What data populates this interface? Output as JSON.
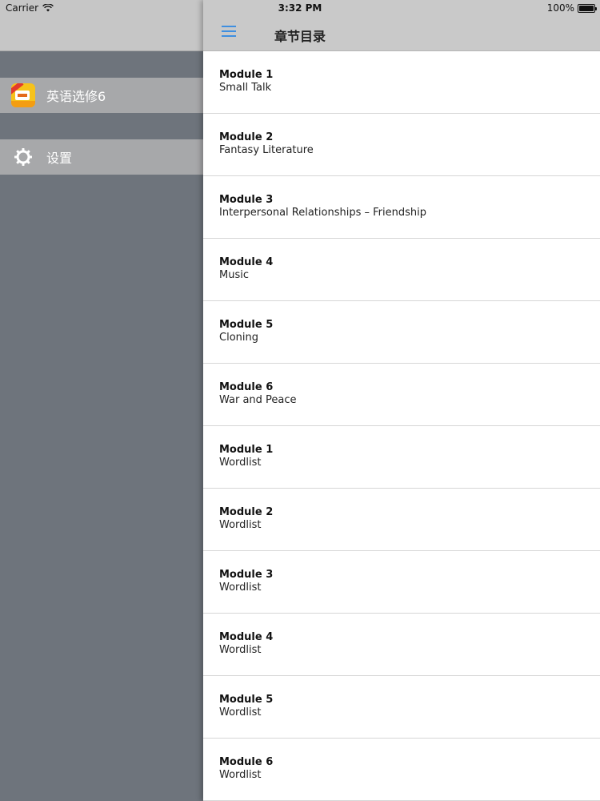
{
  "status_bar": {
    "carrier": "Carrier",
    "time": "3:32 PM",
    "battery": "100%"
  },
  "sidebar": {
    "items": [
      {
        "label": "英语选修6",
        "icon": "book-app-icon"
      },
      {
        "label": "设置",
        "icon": "gear-icon"
      }
    ]
  },
  "navbar": {
    "title": "章节目录",
    "menu_icon": "hamburger-menu-icon",
    "accent": "#3f8fe0"
  },
  "chapters": [
    {
      "title": "Module 1",
      "subtitle": "Small Talk"
    },
    {
      "title": "Module 2",
      "subtitle": "Fantasy Literature"
    },
    {
      "title": "Module 3",
      "subtitle": "Interpersonal Relationships – Friendship"
    },
    {
      "title": "Module 4",
      "subtitle": "Music"
    },
    {
      "title": "Module 5",
      "subtitle": "Cloning"
    },
    {
      "title": "Module 6",
      "subtitle": "War and Peace"
    },
    {
      "title": "Module 1",
      "subtitle": "Wordlist"
    },
    {
      "title": "Module 2",
      "subtitle": "Wordlist"
    },
    {
      "title": "Module 3",
      "subtitle": "Wordlist"
    },
    {
      "title": "Module 4",
      "subtitle": "Wordlist"
    },
    {
      "title": "Module 5",
      "subtitle": "Wordlist"
    },
    {
      "title": "Module 6",
      "subtitle": "Wordlist"
    }
  ]
}
